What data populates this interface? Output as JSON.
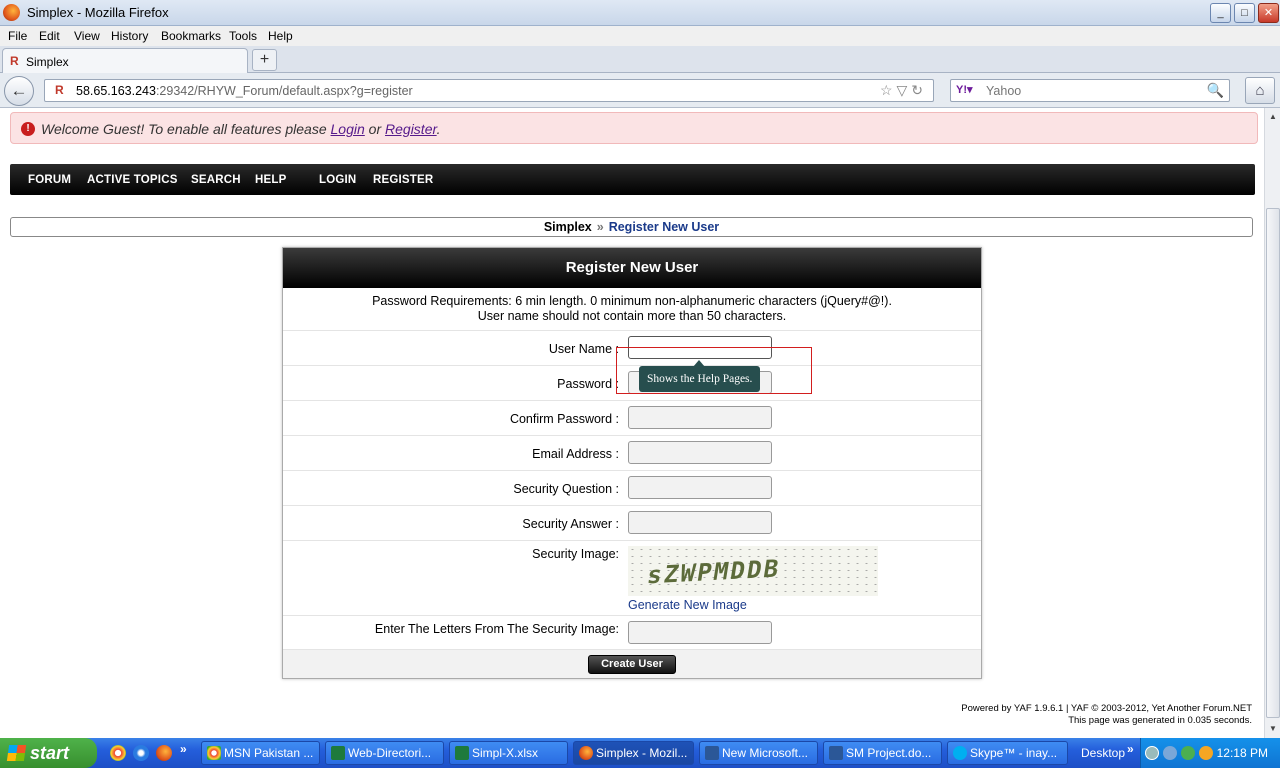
{
  "window": {
    "title": "Simplex - Mozilla Firefox",
    "min": "_",
    "max": "□",
    "close": "✕"
  },
  "menu": [
    "File",
    "Edit",
    "View",
    "History",
    "Bookmarks",
    "Tools",
    "Help"
  ],
  "tab": {
    "title": "Simplex",
    "favicon": "R",
    "new_tab": "+"
  },
  "nav": {
    "back": "←",
    "site_icon": "R",
    "url_host": "58.65.163.243",
    "url_rest": ":29342/RHYW_Forum/default.aspx?g=register",
    "url_icons": "☆▽↻",
    "search_engine": "Y!▾",
    "search_placeholder": "Yahoo",
    "search_icon": "🔍",
    "home": "⌂"
  },
  "welcome": {
    "icon": "!",
    "prefix": "Welcome Guest! To enable all features please ",
    "login": "Login",
    "or": " or ",
    "register": "Register",
    "suffix": "."
  },
  "main_nav": [
    "FORUM",
    "ACTIVE TOPICS",
    "SEARCH",
    "HELP",
    "LOGIN",
    "REGISTER"
  ],
  "breadcrumb": {
    "root": "Simplex",
    "sep": "»",
    "current": "Register New User"
  },
  "form": {
    "title": "Register New User",
    "requirements_1": "Password Requirements: 6 min length. 0 minimum non-alphanumeric characters (jQuery#@!).",
    "requirements_2": "User name should not contain more than 50 characters.",
    "user_name_label": "User Name :",
    "password_label": "Password :",
    "confirm_password_label": "Confirm Password :",
    "email_label": "Email Address :",
    "security_question_label": "Security Question :",
    "security_answer_label": "Security Answer :",
    "security_image_label": "Security Image:",
    "captcha_text": "sZWPMDDB",
    "generate_link": "Generate New Image",
    "enter_letters_label": "Enter The Letters From The Security Image:",
    "create_button": "Create User"
  },
  "tooltip": "Shows the Help Pages.",
  "footer": {
    "line1": "Powered by YAF 1.9.6.1 | YAF © 2003-2012, Yet Another Forum.NET",
    "line2": "This page was generated in 0.035 seconds."
  },
  "scroll": {
    "up": "▲",
    "down": "▼"
  },
  "taskbar": {
    "start": "start",
    "tasks": [
      "MSN Pakistan ...",
      "Web-Directori...",
      "Simpl-X.xlsx",
      "Simplex - Mozil...",
      "New Microsoft...",
      "SM Project.do...",
      "Skype™ - inay..."
    ],
    "desktop": "Desktop",
    "chevron": "»",
    "clock": "12:18 PM"
  }
}
